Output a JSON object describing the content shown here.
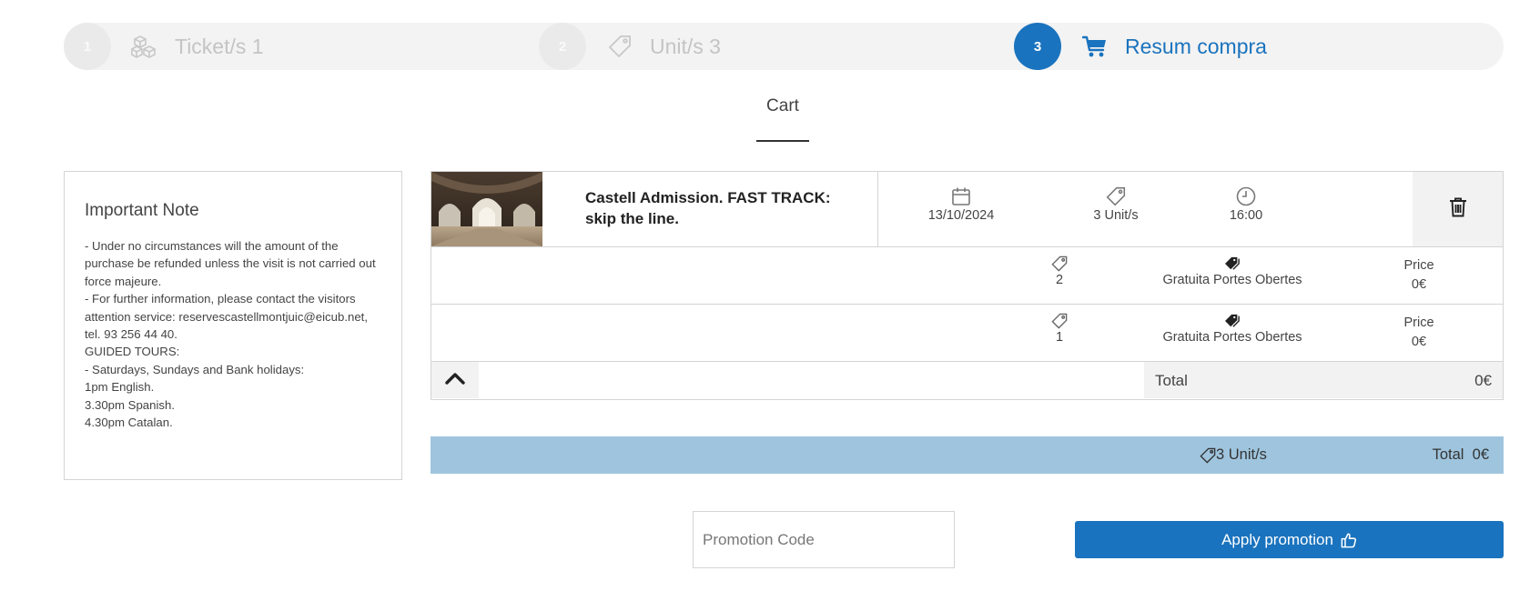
{
  "stepper": {
    "steps": [
      {
        "number": "1",
        "label": "Ticket/s 1",
        "icon": "boxes-icon",
        "state": "inactive"
      },
      {
        "number": "2",
        "label": "Unit/s 3",
        "icon": "tag-icon",
        "state": "inactive"
      },
      {
        "number": "3",
        "label": "Resum compra",
        "icon": "cart-icon",
        "state": "active"
      }
    ]
  },
  "cart": {
    "title": "Cart"
  },
  "note": {
    "title": "Important Note",
    "lines": [
      "- Under no circumstances will the amount of the purchase be refunded unless the visit is not carried out force majeure.",
      "- For further information, please contact the visitors attention service: reservescastellmontjuic@eicub.net, tel. 93 256 44 40.",
      "GUIDED TOURS:",
      "- Saturdays, Sundays and Bank holidays:",
      "1pm English.",
      "3.30pm Spanish.",
      "4.30pm Catalan."
    ]
  },
  "item": {
    "name": "Castell Admission. FAST TRACK: skip the line.",
    "date": "13/10/2024",
    "units": "3 Unit/s",
    "time": "16:00",
    "rows": [
      {
        "qty": "2",
        "type": "Gratuita Portes Obertes",
        "price_label": "Price",
        "price": "0€"
      },
      {
        "qty": "1",
        "type": "Gratuita Portes Obertes",
        "price_label": "Price",
        "price": "0€"
      }
    ],
    "total_label": "Total",
    "total_value": "0€"
  },
  "summary": {
    "units": "3 Unit/s",
    "total_label": "Total",
    "total_value": "0€"
  },
  "promo": {
    "placeholder": "Promotion Code",
    "button_label": "Apply promotion"
  },
  "colors": {
    "accent": "#1a73be",
    "summary_bg": "#9fc5de"
  }
}
